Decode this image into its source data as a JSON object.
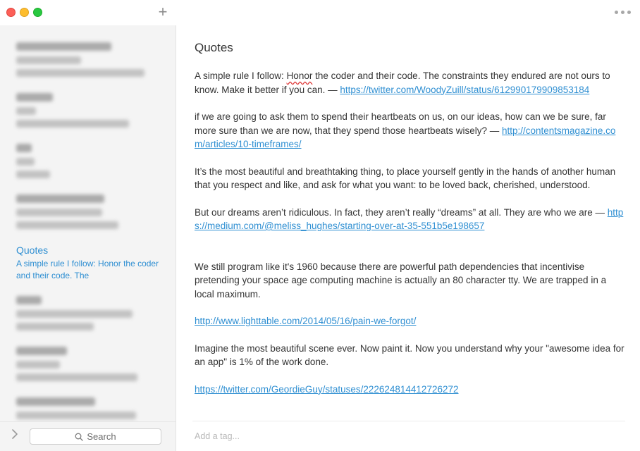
{
  "toolbar": {
    "new_note_symbol": "+",
    "icons": [
      "close-icon",
      "minimize-icon",
      "zoom-icon",
      "plus-icon",
      "more-icon"
    ]
  },
  "sidebar": {
    "active_note": {
      "title": "Quotes",
      "preview": "A simple rule I follow: Honor the coder and their code. The"
    },
    "search_placeholder": "Search",
    "accent_color": "#2f8fd2"
  },
  "note": {
    "title": "Quotes",
    "paragraphs": [
      {
        "pre": "A simple rule I follow: ",
        "spell": "Honor",
        "text": " the coder and their code. The constraints they endured are not ours to know. Make it better if you can. — ",
        "link": "https://twitter.com/WoodyZuill/status/612990179909853184"
      },
      {
        "text": "if we are going to ask them to spend their heartbeats on us, on our ideas, how can we be sure, far more sure than we are now, that they spend those heartbeats wisely? — ",
        "link": "http://contentsmagazine.com/articles/10-timeframes/"
      },
      {
        "text": "It’s the most beautiful and breathtaking thing, to place yourself gently in the hands of another human that you respect and like, and ask for what you want: to be loved back, cherished, understood."
      },
      {
        "text": "But our dreams aren’t ridiculous. In fact, they aren’t really “dreams” at all. They are who we are — ",
        "link": "https://medium.com/@meliss_hughes/starting-over-at-35-551b5e198657"
      },
      {
        "text": "We still program like it's 1960 because there are powerful path dependencies that incentivise pretending your space age computing machine is actually an 80 character tty. We are trapped in a local maximum."
      },
      {
        "link": "http://www.lighttable.com/2014/05/16/pain-we-forgot/"
      },
      {
        "text": "Imagine the most beautiful scene ever.  Now paint it.  Now you understand why your \"awesome idea for an app\" is 1% of the work done."
      },
      {
        "link": "https://twitter.com/GeordieGuy/statuses/222624814412726272"
      }
    ],
    "tag_placeholder": "Add a tag..."
  }
}
